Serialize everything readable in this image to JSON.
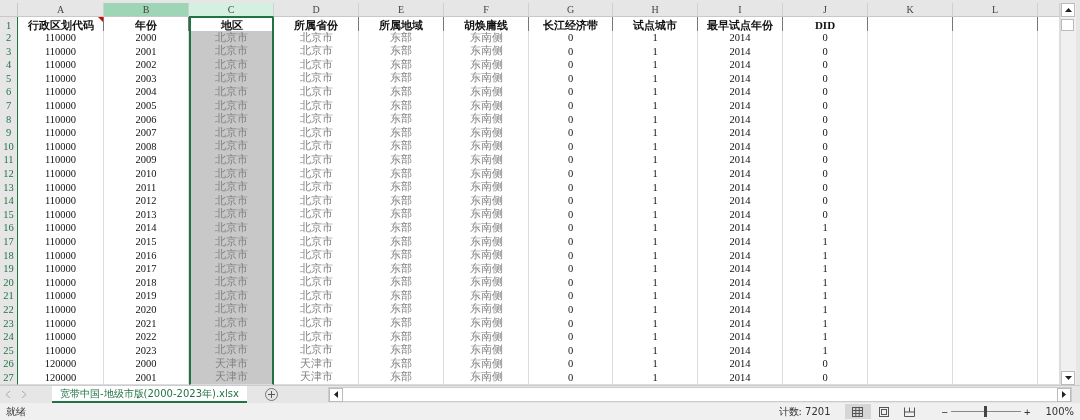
{
  "columns": [
    {
      "letter": "A",
      "header": "行政区划代码",
      "muted": false,
      "selected": false,
      "highlighted": false,
      "comment": true
    },
    {
      "letter": "B",
      "header": "年份",
      "muted": false,
      "selected": false,
      "highlighted": true,
      "comment": false
    },
    {
      "letter": "C",
      "header": "地区",
      "muted": true,
      "selected": true,
      "highlighted": false,
      "comment": false
    },
    {
      "letter": "D",
      "header": "所属省份",
      "muted": true,
      "selected": false,
      "highlighted": false,
      "comment": false
    },
    {
      "letter": "E",
      "header": "所属地域",
      "muted": true,
      "selected": false,
      "highlighted": false,
      "comment": false
    },
    {
      "letter": "F",
      "header": "胡焕庸线",
      "muted": true,
      "selected": false,
      "highlighted": false,
      "comment": false
    },
    {
      "letter": "G",
      "header": "长江经济带",
      "muted": false,
      "selected": false,
      "highlighted": false,
      "comment": false
    },
    {
      "letter": "H",
      "header": "试点城市",
      "muted": false,
      "selected": false,
      "highlighted": false,
      "comment": false
    },
    {
      "letter": "I",
      "header": "最早试点年份",
      "muted": false,
      "selected": false,
      "highlighted": false,
      "comment": false
    },
    {
      "letter": "J",
      "header": "DID",
      "muted": false,
      "selected": false,
      "highlighted": false,
      "comment": false
    },
    {
      "letter": "K",
      "selected": false,
      "highlighted": false,
      "comment": false
    },
    {
      "letter": "L",
      "selected": false,
      "highlighted": false,
      "comment": false
    }
  ],
  "rows": [
    {
      "num": "1"
    },
    {
      "num": "2",
      "cells": [
        "110000",
        "2000",
        "北京市",
        "北京市",
        "东部",
        "东南侧",
        "0",
        "1",
        "2014",
        "0"
      ]
    },
    {
      "num": "3",
      "cells": [
        "110000",
        "2001",
        "北京市",
        "北京市",
        "东部",
        "东南侧",
        "0",
        "1",
        "2014",
        "0"
      ]
    },
    {
      "num": "4",
      "cells": [
        "110000",
        "2002",
        "北京市",
        "北京市",
        "东部",
        "东南侧",
        "0",
        "1",
        "2014",
        "0"
      ]
    },
    {
      "num": "5",
      "cells": [
        "110000",
        "2003",
        "北京市",
        "北京市",
        "东部",
        "东南侧",
        "0",
        "1",
        "2014",
        "0"
      ]
    },
    {
      "num": "6",
      "cells": [
        "110000",
        "2004",
        "北京市",
        "北京市",
        "东部",
        "东南侧",
        "0",
        "1",
        "2014",
        "0"
      ]
    },
    {
      "num": "7",
      "cells": [
        "110000",
        "2005",
        "北京市",
        "北京市",
        "东部",
        "东南侧",
        "0",
        "1",
        "2014",
        "0"
      ]
    },
    {
      "num": "8",
      "cells": [
        "110000",
        "2006",
        "北京市",
        "北京市",
        "东部",
        "东南侧",
        "0",
        "1",
        "2014",
        "0"
      ]
    },
    {
      "num": "9",
      "cells": [
        "110000",
        "2007",
        "北京市",
        "北京市",
        "东部",
        "东南侧",
        "0",
        "1",
        "2014",
        "0"
      ]
    },
    {
      "num": "10",
      "cells": [
        "110000",
        "2008",
        "北京市",
        "北京市",
        "东部",
        "东南侧",
        "0",
        "1",
        "2014",
        "0"
      ]
    },
    {
      "num": "11",
      "cells": [
        "110000",
        "2009",
        "北京市",
        "北京市",
        "东部",
        "东南侧",
        "0",
        "1",
        "2014",
        "0"
      ]
    },
    {
      "num": "12",
      "cells": [
        "110000",
        "2010",
        "北京市",
        "北京市",
        "东部",
        "东南侧",
        "0",
        "1",
        "2014",
        "0"
      ]
    },
    {
      "num": "13",
      "cells": [
        "110000",
        "2011",
        "北京市",
        "北京市",
        "东部",
        "东南侧",
        "0",
        "1",
        "2014",
        "0"
      ]
    },
    {
      "num": "14",
      "cells": [
        "110000",
        "2012",
        "北京市",
        "北京市",
        "东部",
        "东南侧",
        "0",
        "1",
        "2014",
        "0"
      ]
    },
    {
      "num": "15",
      "cells": [
        "110000",
        "2013",
        "北京市",
        "北京市",
        "东部",
        "东南侧",
        "0",
        "1",
        "2014",
        "0"
      ]
    },
    {
      "num": "16",
      "cells": [
        "110000",
        "2014",
        "北京市",
        "北京市",
        "东部",
        "东南侧",
        "0",
        "1",
        "2014",
        "1"
      ]
    },
    {
      "num": "17",
      "cells": [
        "110000",
        "2015",
        "北京市",
        "北京市",
        "东部",
        "东南侧",
        "0",
        "1",
        "2014",
        "1"
      ]
    },
    {
      "num": "18",
      "cells": [
        "110000",
        "2016",
        "北京市",
        "北京市",
        "东部",
        "东南侧",
        "0",
        "1",
        "2014",
        "1"
      ]
    },
    {
      "num": "19",
      "cells": [
        "110000",
        "2017",
        "北京市",
        "北京市",
        "东部",
        "东南侧",
        "0",
        "1",
        "2014",
        "1"
      ]
    },
    {
      "num": "20",
      "cells": [
        "110000",
        "2018",
        "北京市",
        "北京市",
        "东部",
        "东南侧",
        "0",
        "1",
        "2014",
        "1"
      ]
    },
    {
      "num": "21",
      "cells": [
        "110000",
        "2019",
        "北京市",
        "北京市",
        "东部",
        "东南侧",
        "0",
        "1",
        "2014",
        "1"
      ]
    },
    {
      "num": "22",
      "cells": [
        "110000",
        "2020",
        "北京市",
        "北京市",
        "东部",
        "东南侧",
        "0",
        "1",
        "2014",
        "1"
      ]
    },
    {
      "num": "23",
      "cells": [
        "110000",
        "2021",
        "北京市",
        "北京市",
        "东部",
        "东南侧",
        "0",
        "1",
        "2014",
        "1"
      ]
    },
    {
      "num": "24",
      "cells": [
        "110000",
        "2022",
        "北京市",
        "北京市",
        "东部",
        "东南侧",
        "0",
        "1",
        "2014",
        "1"
      ]
    },
    {
      "num": "25",
      "cells": [
        "110000",
        "2023",
        "北京市",
        "北京市",
        "东部",
        "东南侧",
        "0",
        "1",
        "2014",
        "1"
      ]
    },
    {
      "num": "26",
      "cells": [
        "120000",
        "2000",
        "天津市",
        "天津市",
        "东部",
        "东南侧",
        "0",
        "1",
        "2014",
        "0"
      ]
    },
    {
      "num": "27",
      "cells": [
        "120000",
        "2001",
        "天津市",
        "天津市",
        "东部",
        "东南侧",
        "0",
        "1",
        "2014",
        "0"
      ]
    }
  ],
  "sheet_tabs": [
    {
      "label": "宽带中国-地级市版(2000-2023年).xlsx",
      "selected": true
    }
  ],
  "status_bar": {
    "status": "就绪",
    "count": "计数: 7201",
    "views": [
      {
        "kind": "normal",
        "selected": true
      },
      {
        "kind": "layout",
        "selected": false
      },
      {
        "kind": "pagebreak",
        "selected": false
      }
    ],
    "zoom_minus": "−",
    "zoom_plus": "+",
    "zoom_slider": {
      "level": 0.5
    },
    "zoom": "100%"
  }
}
